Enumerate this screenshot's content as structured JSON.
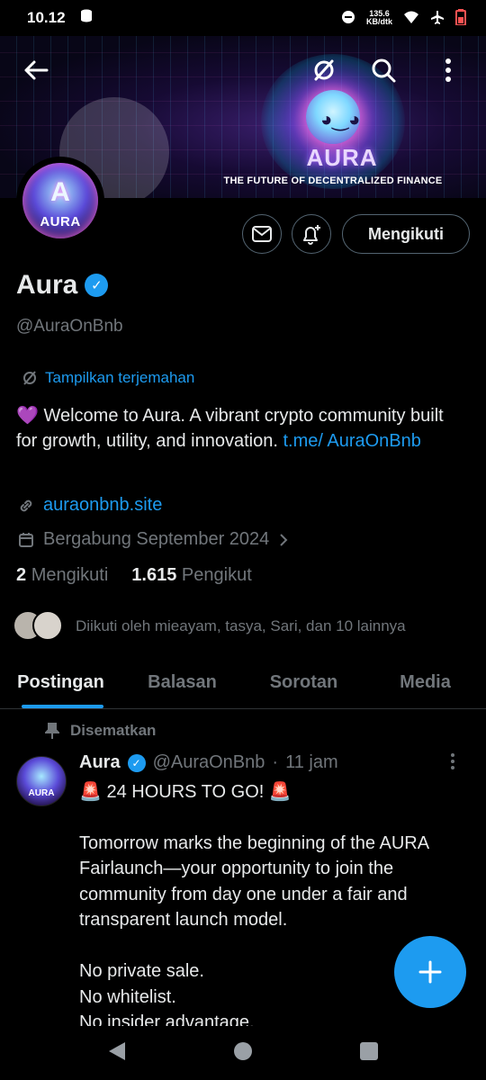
{
  "status_bar": {
    "time": "10.12",
    "net_speed_value": "135.6",
    "net_speed_unit": "KB/dtk"
  },
  "banner": {
    "title": "AURA",
    "subtitle": "THE FUTURE OF DECENTRALIZED FINANCE"
  },
  "avatar": {
    "label": "AURA"
  },
  "actions": {
    "follow_label": "Mengikuti"
  },
  "profile": {
    "name": "Aura",
    "handle": "@AuraOnBnb",
    "translate_label": "Tampilkan terjemahan",
    "bio_text": "Welcome to Aura. A vibrant crypto community built for growth, utility, and innovation.",
    "bio_link": "t.me/ AuraOnBnb",
    "website": "auraonbnb.site",
    "joined": "Bergabung September 2024",
    "following_count": "2",
    "following_label": "Mengikuti",
    "followers_count": "1.615",
    "followers_label": "Pengikut",
    "followed_by": "Diikuti oleh mieayam, tasya, Sari, dan 10 lainnya"
  },
  "tabs": [
    {
      "label": "Postingan",
      "active": true
    },
    {
      "label": "Balasan",
      "active": false
    },
    {
      "label": "Sorotan",
      "active": false
    },
    {
      "label": "Media",
      "active": false
    }
  ],
  "post": {
    "pinned_label": "Disematkan",
    "author_name": "Aura",
    "author_handle": "@AuraOnBnb",
    "separator": "·",
    "time": "11 jam",
    "avatar_label": "AURA",
    "headline": "🚨 24 HOURS TO GO! 🚨",
    "body": "Tomorrow marks the beginning of the AURA Fairlaunch—your opportunity to join the community from day one under a fair and transparent launch model.\n\nNo private sale.\nNo whitelist.\nNo insider advantage."
  },
  "colors": {
    "accent": "#1d9bf0",
    "background": "#000000",
    "text_primary": "#e7e9ea",
    "text_secondary": "#71767b"
  }
}
